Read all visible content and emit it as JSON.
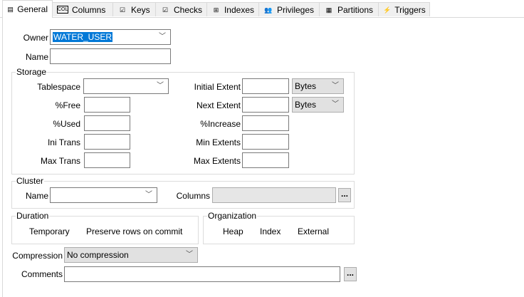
{
  "tabs": [
    {
      "label": "General",
      "icon": "form-icon"
    },
    {
      "label": "Columns",
      "icon": "col-icon"
    },
    {
      "label": "Keys",
      "icon": "key-check-icon"
    },
    {
      "label": "Checks",
      "icon": "check-icon"
    },
    {
      "label": "Indexes",
      "icon": "index-tree-icon"
    },
    {
      "label": "Privileges",
      "icon": "users-icon"
    },
    {
      "label": "Partitions",
      "icon": "grid-icon"
    },
    {
      "label": "Triggers",
      "icon": "trigger-icon"
    }
  ],
  "owner": {
    "label": "Owner",
    "value": "WATER_USER"
  },
  "name": {
    "label": "Name",
    "value": ""
  },
  "storage": {
    "title": "Storage",
    "tablespace": "Tablespace",
    "free": "%Free",
    "used": "%Used",
    "ini_trans": "Ini Trans",
    "max_trans": "Max Trans",
    "initial_extent": "Initial Extent",
    "next_extent": "Next Extent",
    "increase": "%Increase",
    "min_extents": "Min Extents",
    "max_extents": "Max Extents",
    "initial_unit": "Bytes",
    "next_unit": "Bytes"
  },
  "cluster": {
    "title": "Cluster",
    "name": "Name",
    "columns": "Columns",
    "more": "..."
  },
  "duration": {
    "title": "Duration",
    "temporary": "Temporary",
    "preserve": "Preserve rows on commit"
  },
  "organization": {
    "title": "Organization",
    "heap": "Heap",
    "index": "Index",
    "external": "External"
  },
  "compression": {
    "label": "Compression",
    "value": "No compression"
  },
  "comments": {
    "label": "Comments",
    "value": "",
    "more": "..."
  }
}
